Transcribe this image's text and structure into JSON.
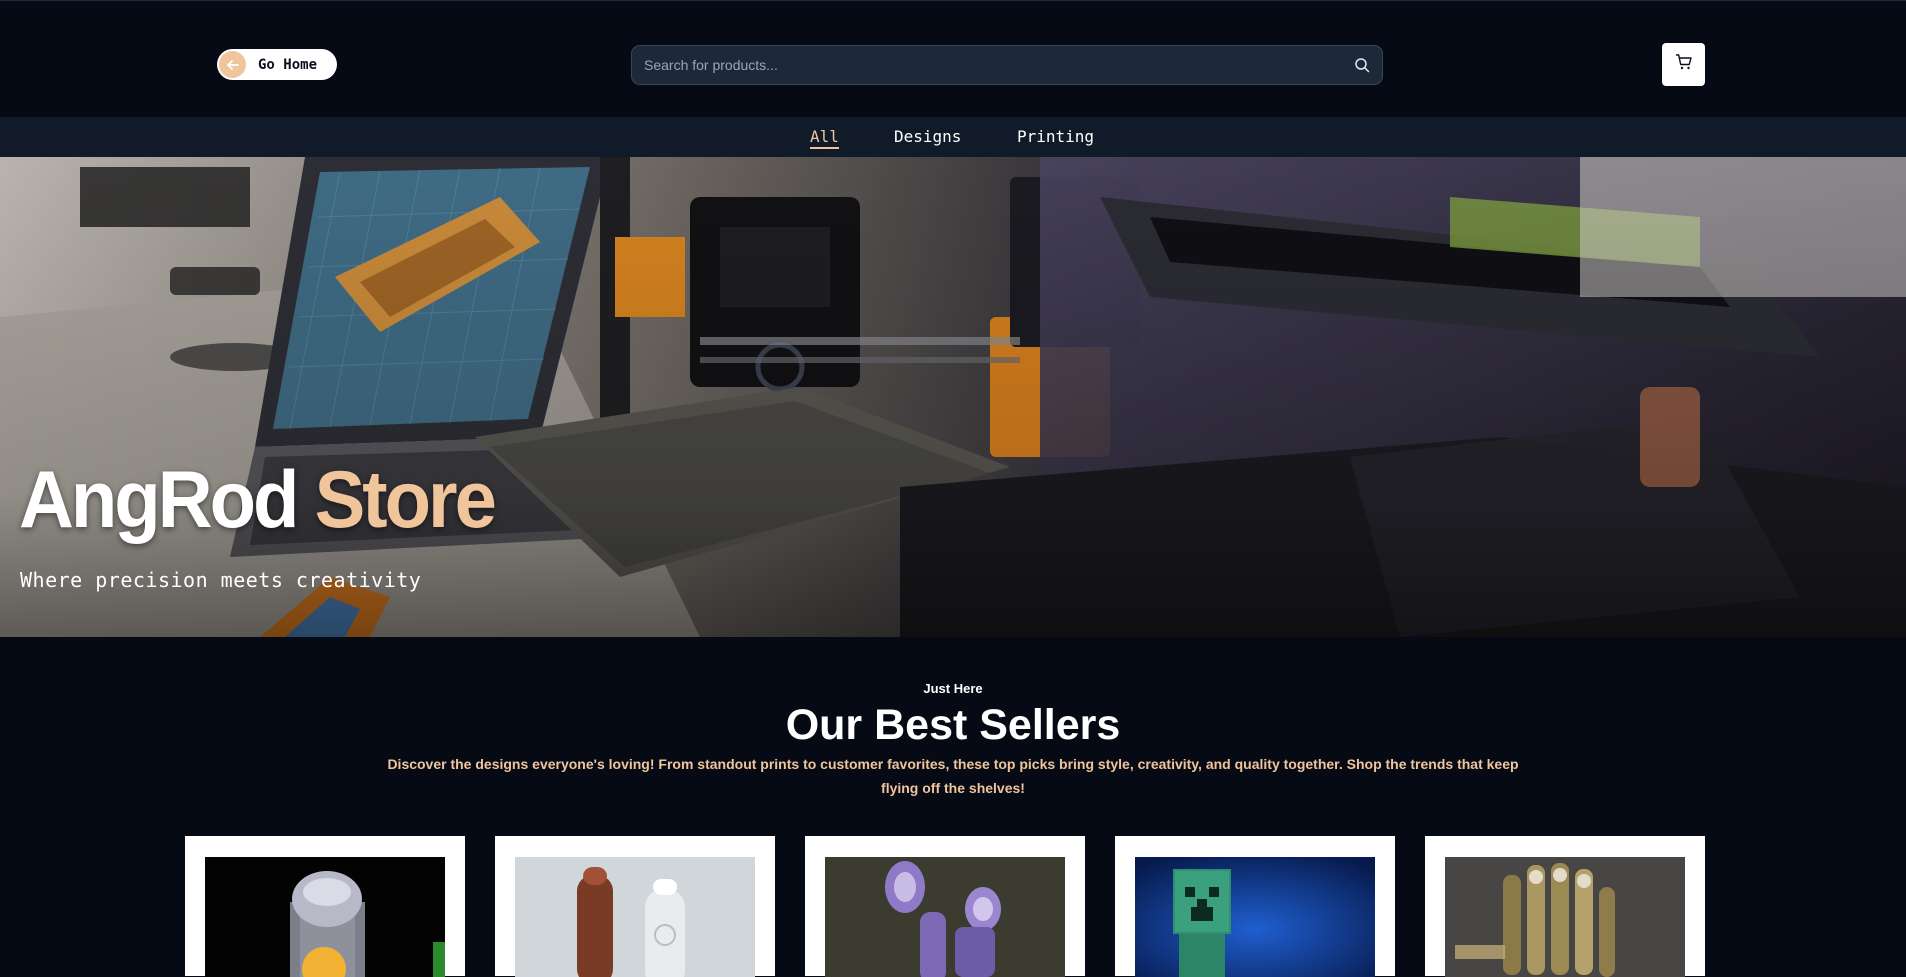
{
  "header": {
    "go_home_label": "Go Home",
    "search_placeholder": "Search for products...",
    "search_icon": "search-icon",
    "cart_icon": "cart-icon",
    "back_icon": "arrow-left-icon"
  },
  "nav": {
    "tabs": [
      {
        "label": "All",
        "active": true
      },
      {
        "label": "Designs",
        "active": false
      },
      {
        "label": "Printing",
        "active": false
      }
    ]
  },
  "hero": {
    "title_part1": "AngRod",
    "title_part2": "Store",
    "subtitle": "Where precision meets creativity"
  },
  "bestsellers": {
    "kicker": "Just Here",
    "title": "Our Best Sellers",
    "description": "Discover the designs everyone's loving! From standout prints to customer favorites, these top picks bring style, creativity, and quality together. Shop the trends that keep flying off the shelves!",
    "products": [
      {
        "image": "lamp-print-image"
      },
      {
        "image": "bottle-print-image"
      },
      {
        "image": "animatronic-print-image"
      },
      {
        "image": "creeper-print-image"
      },
      {
        "image": "skeleton-hand-print-image"
      }
    ]
  },
  "colors": {
    "background": "#050a14",
    "nav_background": "#111a29",
    "accent": "#f0c59c",
    "search_background": "#1d2939"
  }
}
